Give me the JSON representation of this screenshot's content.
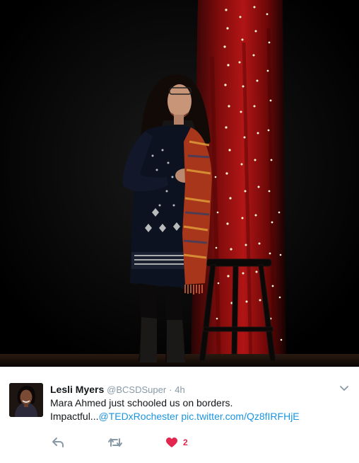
{
  "photo": {
    "subject": "speaker-on-stage"
  },
  "tweet": {
    "author_name": "Lesli Myers",
    "author_handle": "@BCSDSuper",
    "separator": "·",
    "timestamp": "4h",
    "text_line1": "Mara Ahmed just schooled us on borders.",
    "text_line2_prefix": "Impactful...",
    "mention": "@TEDxRochester",
    "link_space": " ",
    "pic_link": "pic.twitter.com/Qz8fIRFHjE",
    "like_count": "2"
  },
  "icons": {
    "reply": "reply-icon",
    "retweet": "retweet-icon",
    "like": "heart-icon",
    "more": "chevron-down-icon"
  },
  "colors": {
    "link": "#1b95e0",
    "like_active": "#e2264d",
    "action_gray": "#8899a6",
    "name": "#14171a"
  }
}
